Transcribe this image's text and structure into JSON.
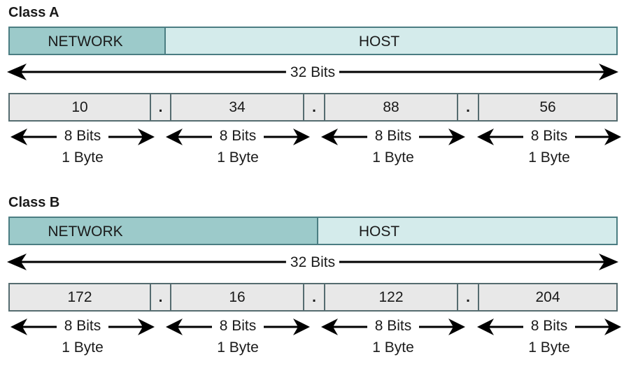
{
  "classes": [
    {
      "title": "Class A",
      "network_label": "NETWORK",
      "host_label": "HOST",
      "total_label": "32 Bits",
      "octets": [
        "10",
        "34",
        "88",
        "56"
      ],
      "separator": ".",
      "octet_bits": "8 Bits",
      "octet_bytes": "1 Byte",
      "network_octets": 1
    },
    {
      "title": "Class B",
      "network_label": "NETWORK",
      "host_label": "HOST",
      "total_label": "32 Bits",
      "octets": [
        "172",
        "16",
        "122",
        "204"
      ],
      "separator": ".",
      "octet_bits": "8 Bits",
      "octet_bytes": "1 Byte",
      "network_octets": 2
    }
  ],
  "colors": {
    "network": "#9ccaca",
    "host": "#d4ebeb",
    "octet": "#e8e8e8",
    "border": "#4b7d82"
  }
}
